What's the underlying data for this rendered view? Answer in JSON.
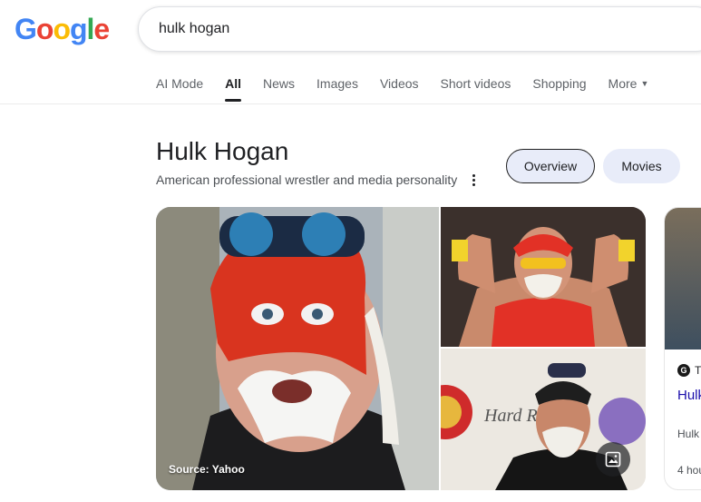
{
  "logo": {
    "letters": [
      "G",
      "o",
      "o",
      "g",
      "l",
      "e"
    ],
    "colors": [
      "#4285F4",
      "#EA4335",
      "#FBBC05",
      "#4285F4",
      "#34A853",
      "#EA4335"
    ]
  },
  "search": {
    "query": "hulk hogan"
  },
  "tabs": [
    {
      "label": "AI Mode"
    },
    {
      "label": "All"
    },
    {
      "label": "News"
    },
    {
      "label": "Images"
    },
    {
      "label": "Videos"
    },
    {
      "label": "Short videos"
    },
    {
      "label": "Shopping"
    },
    {
      "label": "More"
    }
  ],
  "knowledge_panel": {
    "title": "Hulk Hogan",
    "subtitle": "American professional wrestler and media personality",
    "chips": [
      "Overview",
      "Movies"
    ]
  },
  "images": {
    "source_label": "Source: Yahoo"
  },
  "news_card": {
    "source": "T",
    "headline": "Hulk The",
    "snippet": "Hulk arres",
    "time": "4 hou"
  },
  "icons": {
    "more_options": "kebab-vertical-icon",
    "image_gallery": "image-icon",
    "dropdown": "caret-down-icon"
  }
}
